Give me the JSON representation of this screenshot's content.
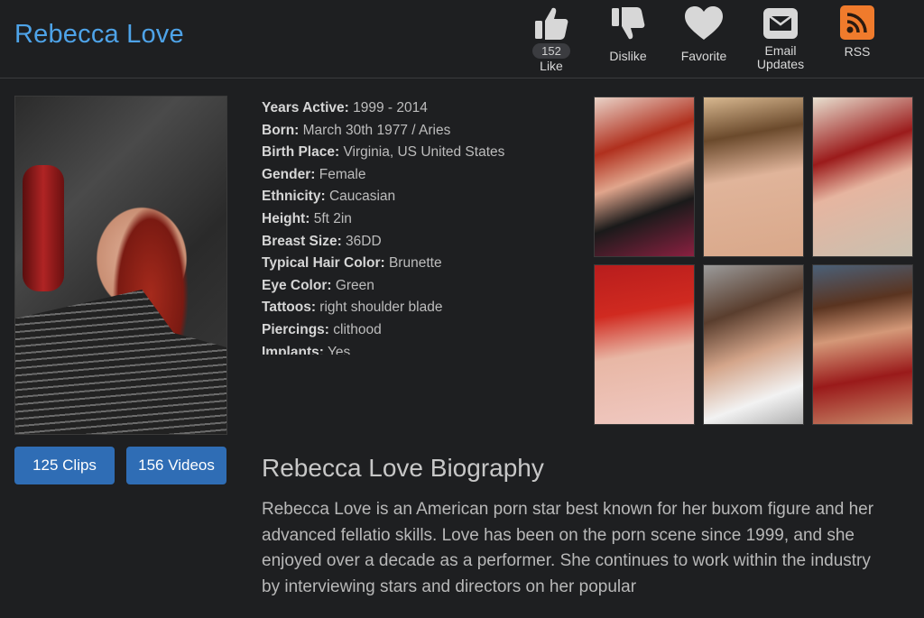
{
  "header": {
    "title": "Rebecca Love",
    "actions": {
      "like": {
        "count": "152",
        "label": "Like"
      },
      "dislike": {
        "label": "Dislike"
      },
      "favorite": {
        "label": "Favorite"
      },
      "email": {
        "label_line1": "Email",
        "label_line2": "Updates"
      },
      "rss": {
        "label": "RSS"
      }
    }
  },
  "buttons": {
    "clips": "125 Clips",
    "videos": "156 Videos"
  },
  "info": [
    {
      "key": "Years Active:",
      "value": "1999 - 2014"
    },
    {
      "key": "Born:",
      "value": "March 30th 1977 / Aries"
    },
    {
      "key": "Birth Place:",
      "value": "Virginia, US United States"
    },
    {
      "key": "Gender:",
      "value": "Female"
    },
    {
      "key": "Ethnicity:",
      "value": "Caucasian"
    },
    {
      "key": "Height:",
      "value": "5ft 2in"
    },
    {
      "key": "Breast Size:",
      "value": "36DD"
    },
    {
      "key": "Typical Hair Color:",
      "value": "Brunette"
    },
    {
      "key": "Eye Color:",
      "value": "Green"
    },
    {
      "key": "Tattoos:",
      "value": "right shoulder blade"
    },
    {
      "key": "Piercings:",
      "value": "clithood"
    },
    {
      "key": "Implants:",
      "value": "Yes"
    }
  ],
  "bio": {
    "title": "Rebecca Love Biography",
    "text": "Rebecca Love is an American porn star best known for her buxom figure and her advanced fellatio skills. Love has been on the porn scene since 1999, and she enjoyed over a decade as a performer. She continues to work within the industry by interviewing stars and directors on her popular"
  },
  "colors": {
    "background": "#1e1f21",
    "title": "#4ea3e8",
    "button": "#2f6db5",
    "rss": "#f07b2c"
  },
  "icons": [
    "thumbs-up-icon",
    "thumbs-down-icon",
    "heart-icon",
    "envelope-icon",
    "rss-icon"
  ]
}
